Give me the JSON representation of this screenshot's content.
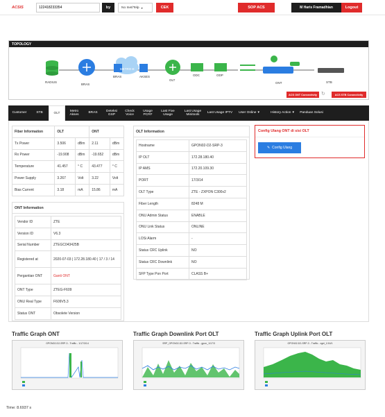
{
  "header": {
    "logo": "ACSIS",
    "search_value": "122418233354",
    "by_label": "by",
    "select_value": "No Inet/Telp",
    "check_button": "CEK",
    "sop_button": "SOP ACS",
    "user_name": "M Haris Framadhian",
    "logout_button": "Logout"
  },
  "topology": {
    "title": "TOPOLOGY",
    "nodes": [
      "RADIUS",
      "BRAS",
      "METRO-E",
      "BRAS",
      "AKSES",
      "OLT",
      "ODC",
      "ODP",
      "ONT",
      "STB"
    ],
    "ont_badge": "ACS ONT Connectivity",
    "stb_badge": "ACS STB Connectivity"
  },
  "tabs": [
    "Customer",
    "STB",
    "OLT",
    "Metro Akses",
    "BRAS",
    "Deteksi GSP",
    "Check Voice",
    "Usage PCRF",
    "Last Five Usage",
    "Last Usage Minitools",
    "Last Usage IPTV",
    "User Online",
    "History Action",
    "Panduan Solusi"
  ],
  "fiber": {
    "headers": [
      "Fiber Information",
      "OLT",
      "",
      "ONT",
      ""
    ],
    "rows": [
      [
        "Tx Power",
        "3.506",
        "dBm",
        "2.11",
        "dBm"
      ],
      [
        "Rx Power",
        "-19.908",
        "dBm",
        "-19.652",
        "dBm"
      ],
      [
        "Temperature",
        "41.457",
        "° C",
        "43.477",
        "° C"
      ],
      [
        "Power Supply",
        "3.267",
        "Volt",
        "3.22",
        "Volt"
      ],
      [
        "Bias Current",
        "3.18",
        "mA",
        "15.86",
        "mA"
      ]
    ]
  },
  "ont_info": {
    "title": "ONT Information",
    "rows": [
      [
        "Vendor ID",
        "ZTE"
      ],
      [
        "Version ID",
        "V6.3"
      ],
      [
        "Serial Number",
        "ZTEGC043425B"
      ],
      [
        "Registered at",
        "2020-07-03 | 172.28.180.40 | 17 / 3 / 14"
      ],
      [
        "Pergantian ONT",
        "Ganti ONT"
      ],
      [
        "ONT Type",
        "ZTEG-F609"
      ],
      [
        "ONU Real Type",
        "F609V5.3"
      ],
      [
        "Status ONT",
        "Obsolete Version"
      ]
    ]
  },
  "olt_info": {
    "title": "OLT Information",
    "rows": [
      [
        "Hostname",
        "GPON02-D2-SRP-3"
      ],
      [
        "IP OLT",
        "172.28.180.40"
      ],
      [
        "IP AMS",
        "172.20.109.30"
      ],
      [
        "PORT",
        "17/3/14"
      ],
      [
        "OLT Type",
        "ZTE - ZXPON C300v2"
      ],
      [
        "Fiber Length",
        "8248 M"
      ],
      [
        "ONU Admin Status",
        "ENABLE"
      ],
      [
        "ONU Link Status",
        "ONLINE"
      ],
      [
        "LOSi Alarm",
        "-"
      ],
      [
        "Status CRC Uplink",
        "NO"
      ],
      [
        "Status CRC Downlink",
        "NO"
      ],
      [
        "SFP Type Pon Port",
        "CLASS B+"
      ]
    ]
  },
  "config": {
    "title": "Config Ulang ONT di sisi OLT",
    "button": "Config Ulang"
  },
  "graphs": [
    {
      "title": "Traffic Graph ONT",
      "caption": "GPON02-D2-SRP-3 - Traffic - 1/17/3/14"
    },
    {
      "title": "Traffic Graph Downlink Port OLT",
      "caption": "SRP_GPON02-D2-SRP-3 - Traffic - gpon_1/17/3"
    },
    {
      "title": "Traffic Graph Uplink Port OLT",
      "caption": "GPON02-D2-SRP-3 - Traffic - xgei_1/16/1"
    }
  ],
  "footer": {
    "time": "Time: 8.6937 s"
  },
  "colors": {
    "red": "#e02b2b",
    "dark": "#1e1e1e",
    "blue": "#2b7de1",
    "green": "#3bb54a"
  }
}
